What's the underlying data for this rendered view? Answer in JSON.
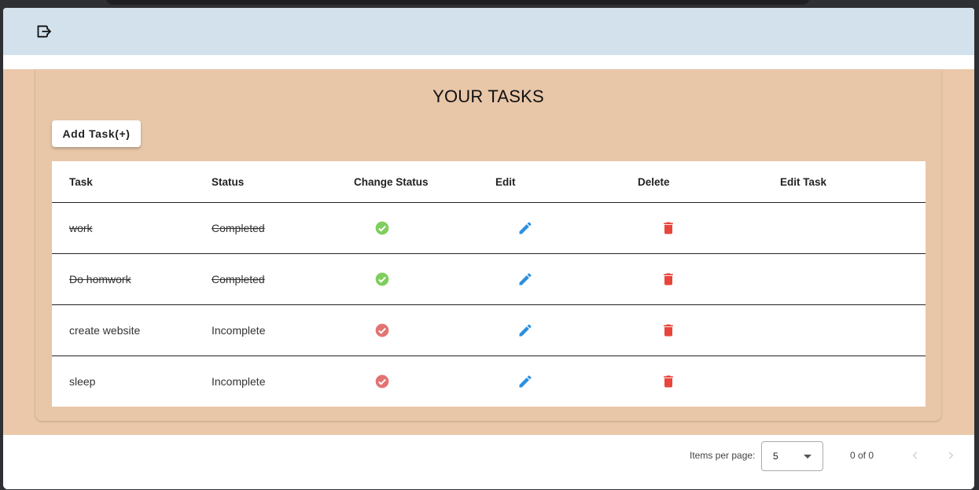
{
  "header": {
    "logout_icon": "logout-icon"
  },
  "page": {
    "title": "YOUR TASKS",
    "add_button_label": "Add Task(+)"
  },
  "table": {
    "columns": [
      "Task",
      "Status",
      "Change Status",
      "Edit",
      "Delete",
      "Edit Task"
    ],
    "rows": [
      {
        "task": "work",
        "status": "Completed",
        "completed": true
      },
      {
        "task": "Do homwork",
        "status": "Completed",
        "completed": true
      },
      {
        "task": "create website",
        "status": "Incomplete",
        "completed": false
      },
      {
        "task": "sleep",
        "status": "Incomplete",
        "completed": false
      }
    ]
  },
  "paginator": {
    "items_per_page_label": "Items per page:",
    "items_per_page_value": "5",
    "range_label": "0 of 0"
  },
  "colors": {
    "appbar": "#d2e1ec",
    "background": "#ebc8aa",
    "complete_green": "#7fce5e",
    "incomplete_red": "#e37373",
    "edit_blue": "#2a8fe0",
    "delete_red": "#e8453c"
  }
}
